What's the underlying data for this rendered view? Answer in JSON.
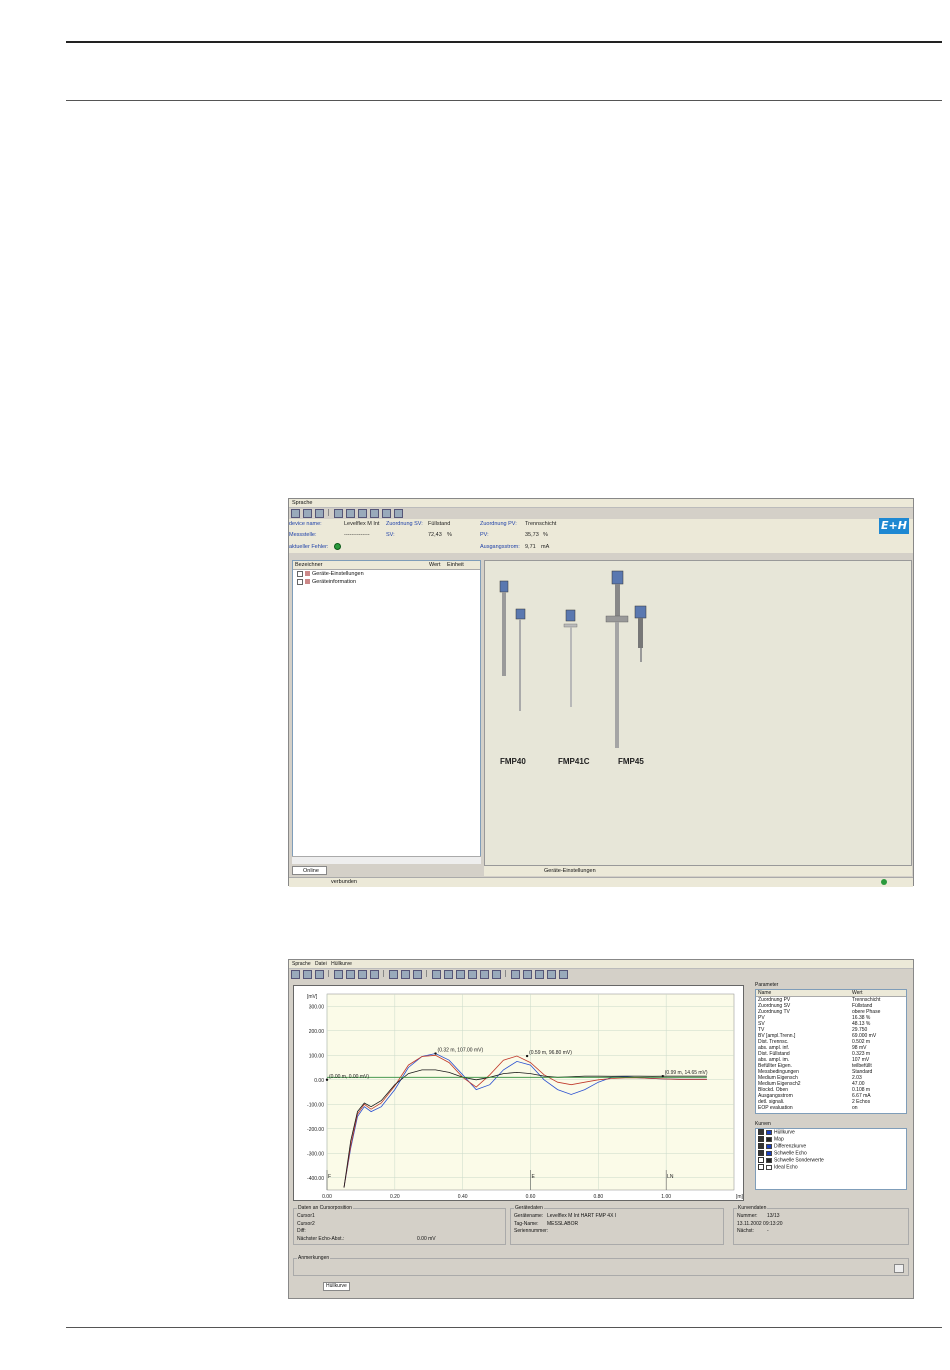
{
  "screen1": {
    "menu": [
      "Sprache"
    ],
    "header": {
      "device_name_label": "device name:",
      "device_name_value": "Levelflex M Int",
      "assignment_sv_label": "Zuordnung SV:",
      "assignment_sv_value": "Füllstand",
      "assignment_pv_label": "Zuordnung PV:",
      "assignment_pv_value": "Trennschicht",
      "measured_value_label": "Messstelle:",
      "measured_value_value": "--------------",
      "sv_label": "SV:",
      "sv_value": "72,43",
      "sv_unit": "%",
      "pv_label": "PV:",
      "pv_value": "35,73",
      "pv_unit": "%",
      "current_error_label": "aktueller Fehler:",
      "output_current_label": "Ausgangsstrom:",
      "output_current_value": "9,71",
      "output_current_unit": "mA",
      "logo": "E+H"
    },
    "tree": {
      "col_name": "Bezeichner",
      "col_value": "Wert",
      "col_unit": "Einheit",
      "items": [
        "Geräte-Einstellungen",
        "Geräteinformation"
      ]
    },
    "tab_online": "Online",
    "statusbar_text": "verbunden",
    "pane_status": "Geräte-Einstellungen",
    "devices": [
      "FMP40",
      "FMP41C",
      "FMP45"
    ]
  },
  "screen2": {
    "menu": [
      "Sprache",
      "Datei",
      "Hüllkurve"
    ],
    "plot": {
      "yunit": "[mV]",
      "xunit": "[m]",
      "annotations": [
        "(0.32 m, 107.00 mV)",
        "(0.59 m, 96.80 mV)",
        "(0.00 m, 0.00 mV)",
        "(0.99 m, 14.65 mV)"
      ],
      "marker_f": "F",
      "marker_e": "E",
      "marker_ln": "LN"
    },
    "params": {
      "title": "Parameter",
      "col_name": "Name",
      "col_value": "Wert",
      "rows": [
        [
          "Zuordnung PV",
          "Trennschicht"
        ],
        [
          "Zuordnung SV",
          "Füllstand"
        ],
        [
          "Zuordnung TV",
          "obere Phase"
        ],
        [
          "PV",
          "16.38  %"
        ],
        [
          "SV",
          "48.13  %"
        ],
        [
          "TV",
          "29.750"
        ],
        [
          "BV [ampl.Trenn.]",
          "69.000  mV"
        ],
        [
          "Dist. Trennsc.",
          "0.502  m"
        ],
        [
          "abs. ampl. inf.",
          "98  mV"
        ],
        [
          "Dist. Füllstand",
          "0.323  m"
        ],
        [
          "abs. ampl. im.",
          "107  mV"
        ],
        [
          "Befüllter Eigen.",
          "teilbefüllt"
        ],
        [
          "Messbedingungen",
          "Standard"
        ],
        [
          "Medium Eigensch",
          "2.03"
        ],
        [
          "Medium Eigensch2",
          "47.00"
        ],
        [
          "Blockd. Oben",
          "0.108  m"
        ],
        [
          "Ausgangsstrom",
          "6.67  mA"
        ],
        [
          "detl. signali.",
          "2 Echos"
        ],
        [
          "EOP evaluation",
          "on"
        ]
      ]
    },
    "curves": {
      "title": "Kurven",
      "items": [
        {
          "label": "Hüllkurve",
          "checked": true,
          "color": "#1a3fbf"
        },
        {
          "label": "Map",
          "checked": true,
          "color": "#222222"
        },
        {
          "label": "Differenzkurve",
          "checked": true,
          "color": "#1a3fbf"
        },
        {
          "label": "Schwelle Echo",
          "checked": true,
          "color": "#1a3fbf"
        },
        {
          "label": "Schwelle Sonderwerte",
          "checked": false,
          "color": "#222222"
        },
        {
          "label": "Ideal Echo",
          "checked": false,
          "color": "#ffffff"
        }
      ]
    },
    "cursor_box": {
      "title": "Daten an Cursorposition",
      "rows": [
        [
          "Cursor1",
          ""
        ],
        [
          "Cursor2",
          ""
        ],
        [
          "Diff:",
          ""
        ],
        [
          "Nächster Echo-Abst.:",
          "0.00 mV"
        ]
      ]
    },
    "device_box": {
      "title": "Gerätedaten",
      "rows": [
        [
          "Gerätename:",
          "Levelflex M Int HART FMP 4X I"
        ],
        [
          "Tag-Name:",
          "MESSLABOR"
        ],
        [
          "Seriennummer:",
          ""
        ]
      ]
    },
    "curve_data_box": {
      "title": "Kurvendaten",
      "rows": [
        [
          "Nummer:",
          "13/13"
        ],
        [
          "",
          "13.11.2002  09:13:20"
        ],
        [
          "Nächst:",
          "-"
        ]
      ]
    },
    "notes_title": "Anmerkungen",
    "tab_label": "Hüllkurve"
  },
  "chart_data": {
    "type": "line",
    "xlim": [
      0.0,
      1.2
    ],
    "ylim": [
      -450,
      350
    ],
    "xticks": [
      "0.00",
      "0.20",
      "0.40",
      "0.60",
      "0.80",
      "1.00"
    ],
    "yticks": [
      "300.00",
      "200.00",
      "100.00",
      "0.00",
      "-100.00",
      "-200.00",
      "-300.00",
      "-400.00"
    ],
    "series": [
      {
        "color": "#2a4fd0",
        "x": [
          0.05,
          0.07,
          0.09,
          0.11,
          0.13,
          0.16,
          0.2,
          0.24,
          0.28,
          0.32,
          0.36,
          0.4,
          0.44,
          0.48,
          0.52,
          0.56,
          0.6,
          0.64,
          0.68,
          0.72,
          0.76,
          0.8,
          0.84,
          0.88,
          0.92,
          0.96,
          1.0,
          1.04,
          1.08,
          1.12
        ],
        "y": [
          -440,
          -280,
          -150,
          -110,
          -130,
          -110,
          -40,
          50,
          95,
          107,
          80,
          20,
          -40,
          -20,
          40,
          75,
          60,
          0,
          -40,
          -60,
          -40,
          -10,
          10,
          12,
          8,
          5,
          3,
          2,
          2,
          2
        ]
      },
      {
        "color": "#c0392b",
        "x": [
          0.05,
          0.07,
          0.09,
          0.11,
          0.13,
          0.16,
          0.2,
          0.24,
          0.28,
          0.32,
          0.36,
          0.4,
          0.44,
          0.48,
          0.52,
          0.56,
          0.6,
          0.64,
          0.68,
          0.72,
          0.76,
          0.8,
          0.84,
          0.88,
          0.92,
          0.96,
          1.0,
          1.04,
          1.08,
          1.12
        ],
        "y": [
          -440,
          -270,
          -140,
          -100,
          -120,
          -95,
          -25,
          60,
          95,
          100,
          70,
          10,
          -30,
          20,
          80,
          97,
          70,
          20,
          -10,
          -20,
          -10,
          0,
          5,
          8,
          8,
          5,
          3,
          2,
          2,
          2
        ]
      },
      {
        "color": "#1a1a1a",
        "x": [
          0.05,
          0.07,
          0.09,
          0.11,
          0.13,
          0.16,
          0.2,
          0.24,
          0.28,
          0.32,
          0.36,
          0.4,
          0.44,
          0.48,
          0.52,
          0.56,
          0.6,
          0.64,
          0.68,
          0.72,
          0.76,
          0.8,
          0.84,
          0.88,
          0.92,
          0.96,
          1.0,
          1.04,
          1.08,
          1.12
        ],
        "y": [
          -440,
          -250,
          -130,
          -95,
          -110,
          -85,
          -20,
          25,
          40,
          40,
          30,
          10,
          0,
          10,
          25,
          30,
          25,
          15,
          10,
          12,
          15,
          15,
          14,
          15,
          15,
          14,
          15,
          15,
          15,
          15
        ]
      },
      {
        "color": "#2e8b3a",
        "x": [
          0.0,
          1.12
        ],
        "y": [
          10,
          10
        ]
      }
    ]
  }
}
